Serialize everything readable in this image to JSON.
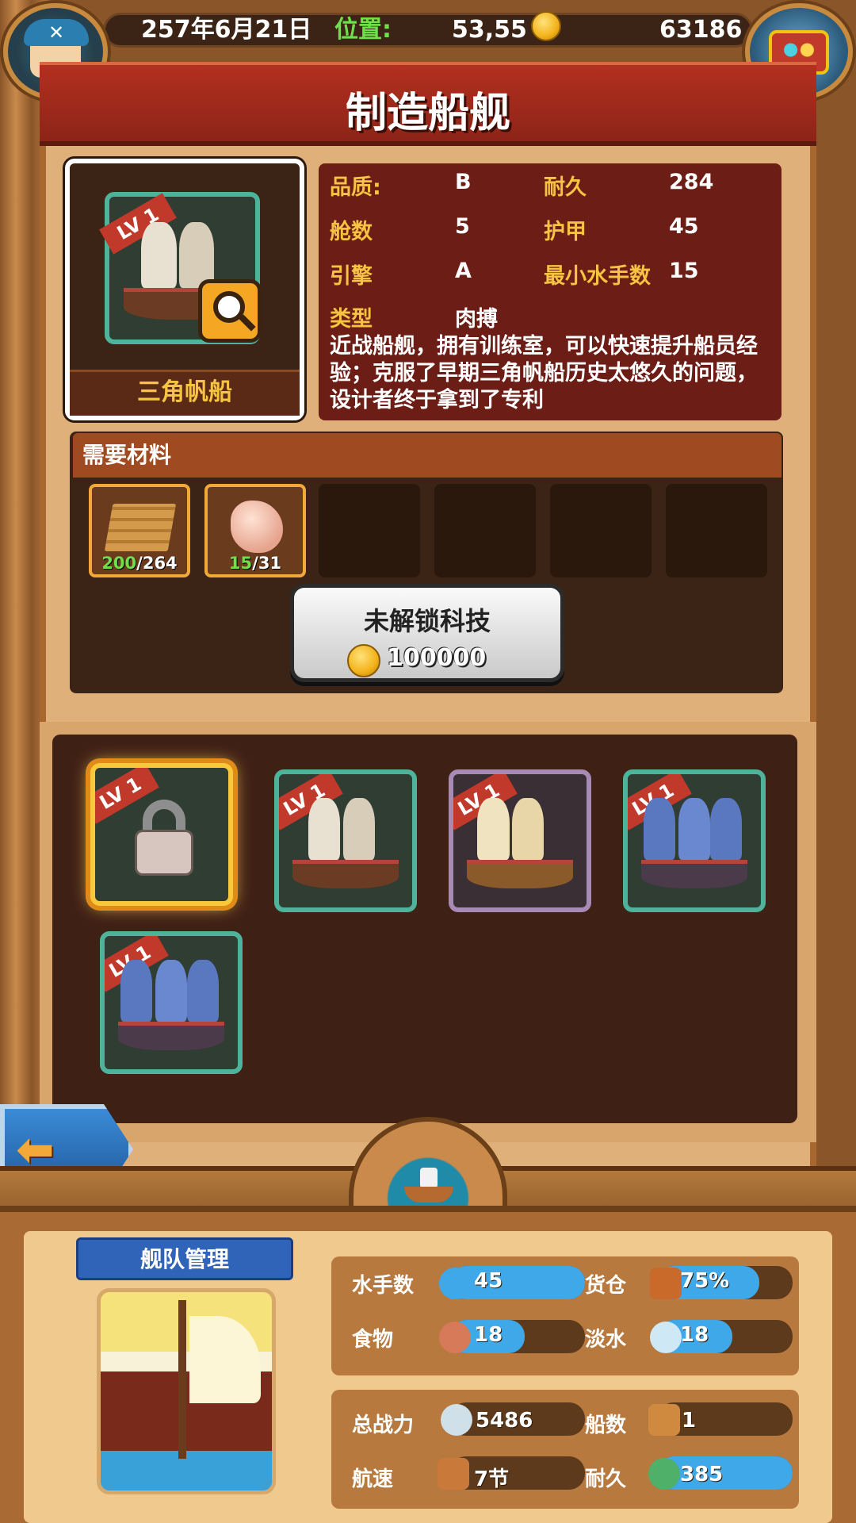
{
  "header": {
    "date": "257年6月21日",
    "location_label": "位置:",
    "location_value": "53,55",
    "gold": "63186"
  },
  "title": "制造船舰",
  "ship": {
    "name": "三角帆船",
    "level": "LV 1",
    "stats": [
      {
        "label": "品质:",
        "value": "B"
      },
      {
        "label": "耐久",
        "value": "284"
      },
      {
        "label": "舱数",
        "value": "5"
      },
      {
        "label": "护甲",
        "value": "45"
      },
      {
        "label": "引擎",
        "value": "A"
      },
      {
        "label": "最小水手数",
        "value": "15"
      },
      {
        "label": "类型",
        "value": "肉搏"
      }
    ],
    "description": "近战船舰，拥有训练室，可以快速提升船员经验；克服了早期三角帆船历史太悠久的问题，设计者终于拿到了专利"
  },
  "materials": {
    "title": "需要材料",
    "items": [
      {
        "icon": "wood-icon",
        "have": "200",
        "need": "/264"
      },
      {
        "icon": "stone-icon",
        "have": "15",
        "need": "/31"
      }
    ]
  },
  "unlock": {
    "label": "未解锁科技",
    "cost": "100000"
  },
  "ship_list": [
    {
      "level": "LV 1",
      "locked": true,
      "selected": true
    },
    {
      "level": "LV 1",
      "locked": false,
      "selected": false
    },
    {
      "level": "LV 1",
      "locked": false,
      "selected": false
    },
    {
      "level": "LV 1",
      "locked": false,
      "selected": false
    },
    {
      "level": "LV 1",
      "locked": false,
      "selected": false
    }
  ],
  "fleet": {
    "title": "舰队管理",
    "stats": {
      "sailors": {
        "label": "水手数",
        "value": "45"
      },
      "cargo": {
        "label": "货仓",
        "value": "75%"
      },
      "food": {
        "label": "食物",
        "value": "18"
      },
      "water": {
        "label": "淡水",
        "value": "18"
      },
      "power": {
        "label": "总战力",
        "value": "5486"
      },
      "ship_count": {
        "label": "船数",
        "value": "1"
      },
      "speed": {
        "label": "航速",
        "value": "7节"
      },
      "durability": {
        "label": "耐久",
        "value": "385"
      }
    }
  },
  "colors": {
    "accent_gold": "#f6c343",
    "accent_green": "#6fe04b",
    "bar_blue": "#3fa8e8",
    "title_red": "#b3301f"
  }
}
